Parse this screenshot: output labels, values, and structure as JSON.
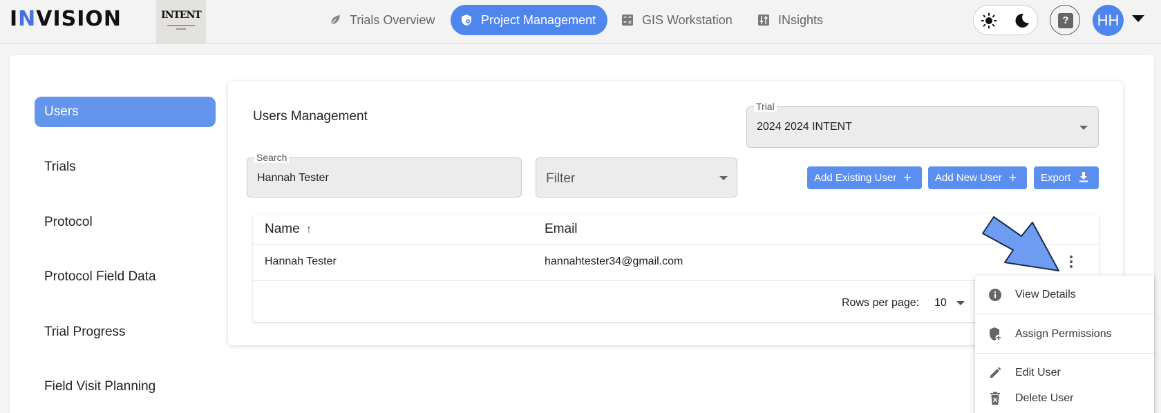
{
  "app": {
    "logo_prefix": "I",
    "logo_accent": "N",
    "logo_rest": "VISION",
    "org_logo_text": "INTENT"
  },
  "nav": {
    "items": [
      {
        "label": "Trials Overview",
        "icon": "leaf-icon",
        "active": false
      },
      {
        "label": "Project Management",
        "icon": "shield-gear-icon",
        "active": true
      },
      {
        "label": "GIS Workstation",
        "icon": "calculator-icon",
        "active": false
      },
      {
        "label": "INsights",
        "icon": "sliders-icon",
        "active": false
      }
    ]
  },
  "header_actions": {
    "help_label": "?",
    "avatar_initials": "HH"
  },
  "sidebar": {
    "items": [
      {
        "label": "Users",
        "active": true
      },
      {
        "label": "Trials",
        "active": false
      },
      {
        "label": "Protocol",
        "active": false
      },
      {
        "label": "Protocol Field Data",
        "active": false
      },
      {
        "label": "Trial Progress",
        "active": false
      },
      {
        "label": "Field Visit Planning",
        "active": false
      }
    ]
  },
  "users_panel": {
    "title": "Users Management",
    "trial_label": "Trial",
    "trial_value": "2024 2024 INTENT",
    "search_label": "Search",
    "search_value": "Hannah Tester",
    "filter_placeholder": "Filter",
    "buttons": {
      "add_existing": "Add Existing User",
      "add_new": "Add New User",
      "export": "Export"
    },
    "table": {
      "columns": [
        "Name",
        "Email"
      ],
      "sort_indicator": "↑",
      "rows": [
        {
          "name": "Hannah Tester",
          "email": "hannahtester34@gmail.com"
        }
      ],
      "rows_per_page_label": "Rows per page:",
      "rows_per_page_value": "10"
    }
  },
  "row_menu": {
    "items": [
      {
        "label": "View Details",
        "icon": "info-icon"
      },
      {
        "label": "Assign Permissions",
        "icon": "shield-plus-icon"
      },
      {
        "label": "Edit User",
        "icon": "pencil-icon"
      },
      {
        "label": "Delete User",
        "icon": "trash-icon"
      }
    ]
  },
  "colors": {
    "accent": "#4f86ee",
    "sidebar_active": "#6495ed",
    "button": "#5a8ff0",
    "annotation_arrow": "#6d9cf0"
  }
}
